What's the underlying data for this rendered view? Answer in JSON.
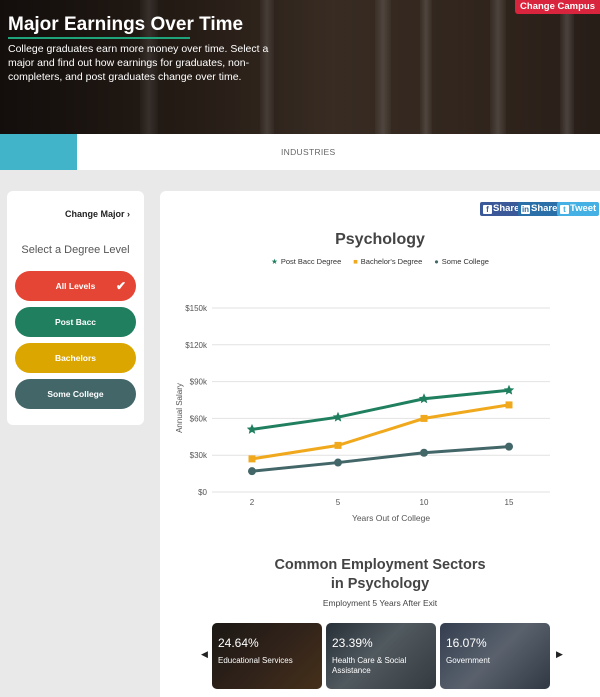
{
  "hero": {
    "title": "Major Earnings Over Time",
    "description": "College graduates earn more money over time. Select a major and find out how earnings for graduates, non-completers, and post graduates change over time.",
    "change_campus": "Change Campus"
  },
  "tabs": {
    "industries": "INDUSTRIES"
  },
  "sidebar": {
    "change_major": "Change Major",
    "heading": "Select a Degree Level",
    "levels": [
      {
        "label": "All Levels",
        "selected": true,
        "color": "#e54535"
      },
      {
        "label": "Post Bacc",
        "color": "#1f7f5e"
      },
      {
        "label": "Bachelors",
        "color": "#dca600"
      },
      {
        "label": "Some College",
        "color": "#436669"
      }
    ]
  },
  "share": {
    "facebook": "Share",
    "linkedin": "Share",
    "twitter": "Tweet"
  },
  "chart_data": {
    "type": "line",
    "title": "Psychology",
    "xlabel": "Years Out of College",
    "ylabel": "Annual Salary",
    "categories": [
      "2",
      "5",
      "10",
      "15"
    ],
    "yticks": [
      "$0",
      "$30k",
      "$60k",
      "$90k",
      "$120k",
      "$150k"
    ],
    "ylim": [
      0,
      150000
    ],
    "grid": true,
    "legend_position": "top",
    "series": [
      {
        "name": "Post Bacc Degree",
        "color": "#1f7f5e",
        "marker": "star",
        "values": [
          51000,
          61000,
          76000,
          83000
        ]
      },
      {
        "name": "Bachelor's Degree",
        "color": "#f0a81c",
        "marker": "square",
        "values": [
          27000,
          38000,
          60000,
          71000
        ]
      },
      {
        "name": "Some College",
        "color": "#436669",
        "marker": "circle",
        "values": [
          17000,
          24000,
          32000,
          37000
        ]
      }
    ]
  },
  "sectors": {
    "title_line1": "Common Employment Sectors",
    "title_line2": "in Psychology",
    "subtitle": "Employment 5 Years After Exit",
    "cards": [
      {
        "percent": "24.64%",
        "label": "Educational Services"
      },
      {
        "percent": "23.39%",
        "label": "Health Care & Social Assistance"
      },
      {
        "percent": "16.07%",
        "label": "Government"
      }
    ]
  }
}
